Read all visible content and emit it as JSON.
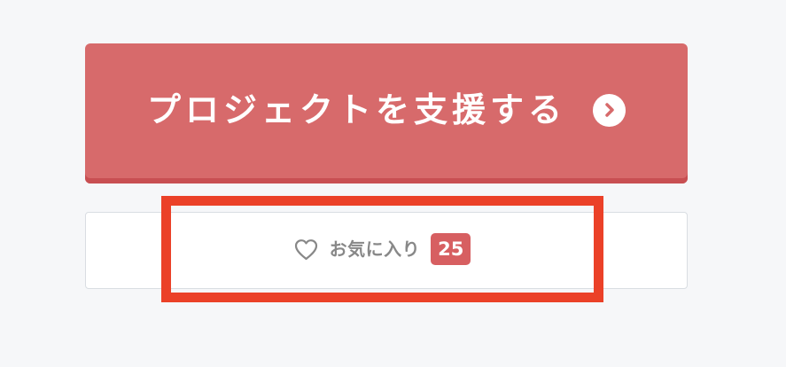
{
  "support": {
    "label": "プロジェクトを支援する",
    "icon": "chevron-right-circle-icon"
  },
  "favorite": {
    "label": "お気に入り",
    "count": "25",
    "icon": "heart-outline-icon"
  },
  "colors": {
    "support_bg": "#d76a6b",
    "support_shadow": "#c84f52",
    "highlight_border": "#eb4128",
    "badge_bg": "#d75f61",
    "favorite_text": "#888888",
    "page_bg": "#f6f7f9"
  }
}
